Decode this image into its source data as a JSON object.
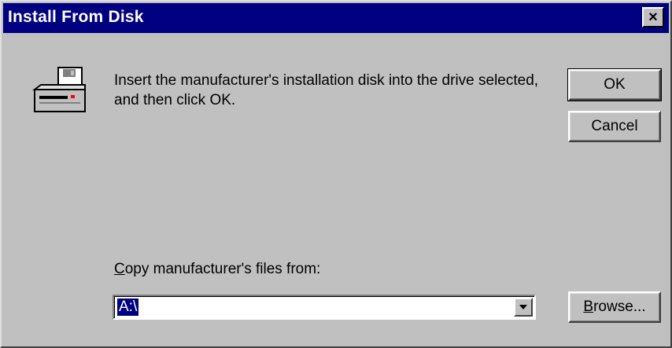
{
  "window": {
    "title": "Install From Disk",
    "close_glyph": "×",
    "colors": {
      "titlebar": "#000080",
      "face": "#c0c0c0",
      "selection": "#000080"
    }
  },
  "message": "Insert the manufacturer's installation disk into the drive selected, and then click OK.",
  "buttons": {
    "ok": "OK",
    "cancel": "Cancel",
    "browse_accel": "B",
    "browse_rest": "rowse..."
  },
  "copy_from": {
    "label_accel": "C",
    "label_rest": "opy manufacturer's files from:",
    "value": "A:\\"
  },
  "icons": {
    "disk": "floppy-drive-icon",
    "dropdown": "chevron-down-icon",
    "close": "close-icon"
  }
}
